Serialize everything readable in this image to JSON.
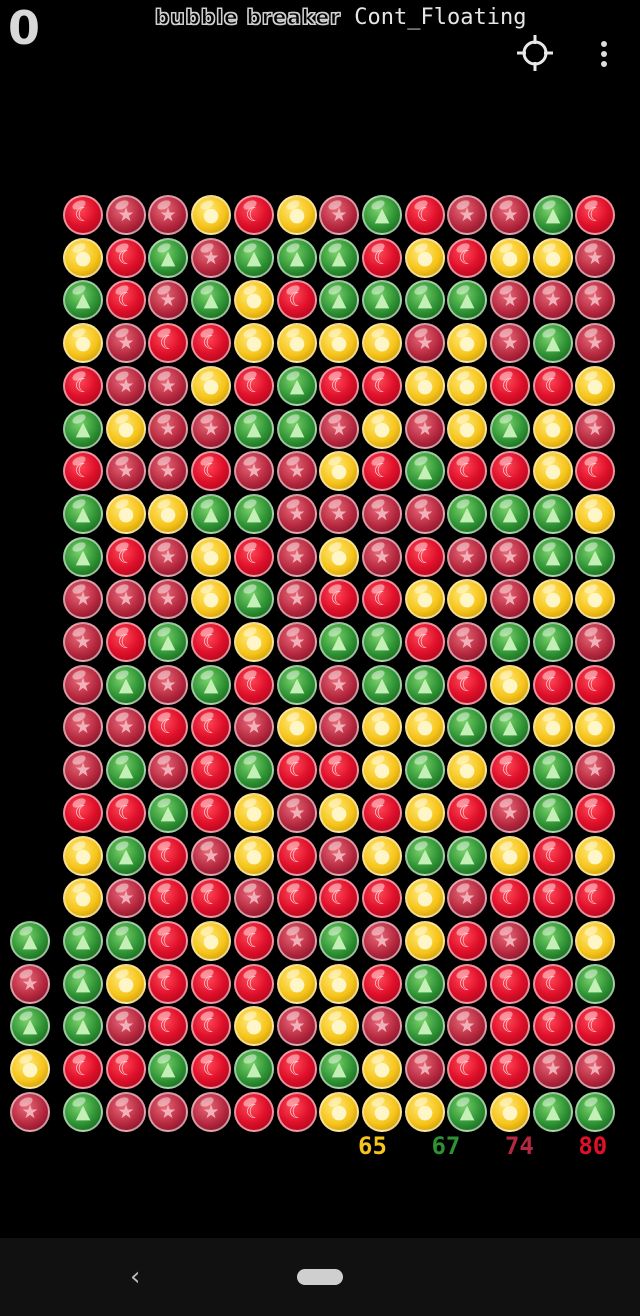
{
  "header": {
    "score": "0",
    "logo": "bubble breaker",
    "mode": "Cont_Floating",
    "target_icon": "crosshair-icon",
    "menu_icon": "more-vert-icon"
  },
  "colors": {
    "R": "#e0102a",
    "S": "#b6283f",
    "G": "#2e9234",
    "Y": "#f6c41a"
  },
  "symbols": {
    "R": "☾",
    "S": "★",
    "G": "▲",
    "Y": "●"
  },
  "board": {
    "columns": 13,
    "rows": [
      "RSSYRYSGRSSGR",
      "YRGSGGGRYRYYS",
      "GRSGYRGGGGSSS",
      "YSRRYYYYSYSGS",
      "RSSYRGRRYYRRY",
      "GYSSGGSYSYGYS",
      "RSSRSSYRGRRYR",
      "GYYGGSSSSGGGY",
      "GRSYRSYSRSSGG",
      "SSSYGSRRYYSYY",
      "SRGRYSGGRSGGS",
      "SGSGRGSGGRYRR",
      "SSRRSYSYYGGYY",
      "SGSRGRRYGYRGS",
      "RRGRYSYRYRSGR",
      "YGRSYRSYGGYRY",
      "YSRRSRRRYSRRR",
      "GGRYRSGSYRSGY",
      "GYRRRYYRGRRRG",
      "GSRRYSYSGSRRR",
      "RRGRGRGYSRRSS",
      "GSSSRRYYYGYGG"
    ]
  },
  "queue": [
    "G",
    "S",
    "G",
    "Y",
    "S"
  ],
  "counts": [
    {
      "value": "65",
      "color": "#f6c41a"
    },
    {
      "value": "67",
      "color": "#2e9234"
    },
    {
      "value": "74",
      "color": "#b6283f"
    },
    {
      "value": "80",
      "color": "#e0102a"
    }
  ],
  "navbar": {
    "back_icon": "back-chevron-icon",
    "home_icon": "home-pill-icon"
  }
}
